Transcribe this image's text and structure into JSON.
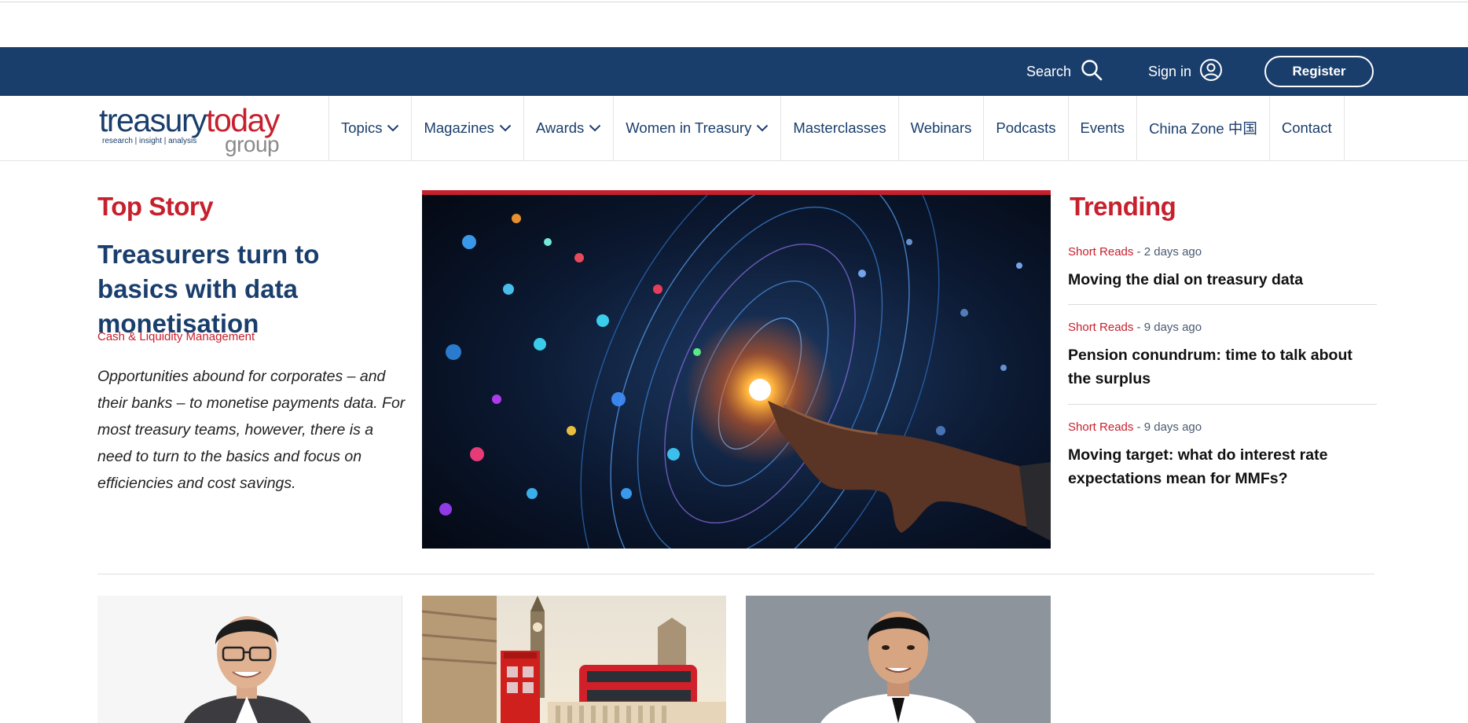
{
  "utility_bar": {
    "search_label": "Search",
    "signin_label": "Sign in",
    "register_label": "Register"
  },
  "logo": {
    "word1": "treasury",
    "word2": "today",
    "tagline": "research | insight | analysis",
    "word3": "group"
  },
  "nav": {
    "items": [
      {
        "label": "Topics",
        "dropdown": true
      },
      {
        "label": "Magazines",
        "dropdown": true
      },
      {
        "label": "Awards",
        "dropdown": true
      },
      {
        "label": "Women in Treasury",
        "dropdown": true
      },
      {
        "label": "Masterclasses",
        "dropdown": false
      },
      {
        "label": "Webinars",
        "dropdown": false
      },
      {
        "label": "Podcasts",
        "dropdown": false
      },
      {
        "label": "Events",
        "dropdown": false
      },
      {
        "label": "China Zone 中国",
        "dropdown": false
      },
      {
        "label": "Contact",
        "dropdown": false
      }
    ]
  },
  "top_story": {
    "section_label": "Top Story",
    "title": "Treasurers turn to basics with data monetisation",
    "category": "Cash & Liquidity Management",
    "summary": "Opportunities abound for corporates – and their banks – to monetise payments data. For most treasury teams, however, there is a need to turn to the basics and focus on efficiencies and cost savings."
  },
  "trending": {
    "section_label": "Trending",
    "items": [
      {
        "category": "Short Reads",
        "age": " - 2 days ago",
        "title": "Moving the dial on treasury data"
      },
      {
        "category": "Short Reads",
        "age": " - 9 days ago",
        "title": "Pension conundrum: time to talk about the surplus"
      },
      {
        "category": "Short Reads",
        "age": " - 9 days ago",
        "title": "Moving target: what do interest rate expectations mean for MMFs?"
      }
    ]
  },
  "colors": {
    "brand_navy": "#1a3e6c",
    "brand_red": "#c7202d",
    "rule": "#e4e4e4"
  },
  "icons": {
    "search": "search-icon",
    "user": "user-circle-icon",
    "chevron": "chevron-down-icon"
  }
}
